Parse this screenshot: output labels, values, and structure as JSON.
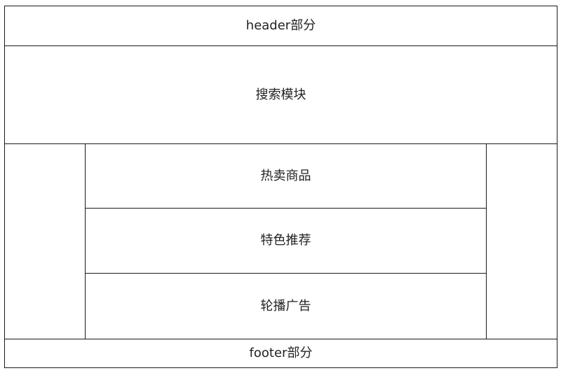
{
  "diagram": {
    "header_label": "header部分",
    "search_label": "搜索模块",
    "hot_label": "热卖商品",
    "featured_label": "特色推荐",
    "carousel_label": "轮播广告",
    "footer_label": "footer部分"
  }
}
